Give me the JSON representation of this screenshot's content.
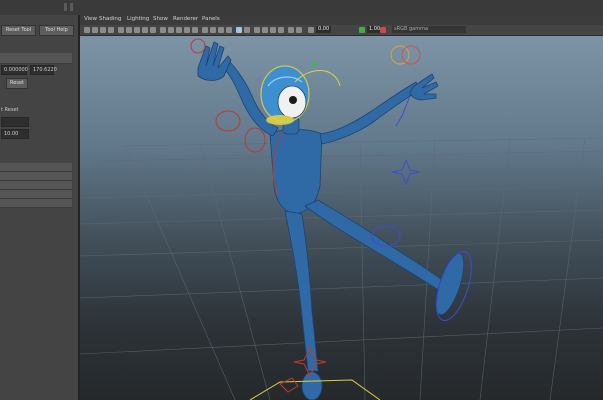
{
  "left_panel": {
    "buttons": {
      "reset_tool": "Reset Tool",
      "tool_help": "Tool Help",
      "reset": "Reset"
    },
    "fields": {
      "value_a": "0.000000",
      "value_b": "170.6220"
    },
    "label_reset_partial": "t Reset",
    "field_partial": "10.00"
  },
  "viewport": {
    "menus": [
      "View",
      "Shading",
      "Lighting",
      "Show",
      "Renderer",
      "Panels"
    ],
    "toolbar": {
      "value_1": "0.00",
      "value_2": "1.00",
      "color_space": "sRGB gamma"
    }
  },
  "colors": {
    "character": "#2e6aa8",
    "helmet": "#3d8fd0",
    "control_red": "#c0392b",
    "control_blue": "#3a4ed0",
    "control_yellow": "#e0d040",
    "grid": "#5d6b75"
  }
}
